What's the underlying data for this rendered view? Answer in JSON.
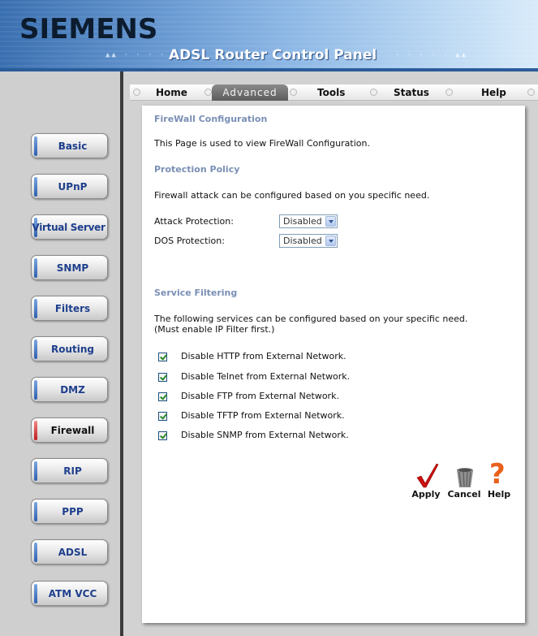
{
  "header": {
    "logo": "SIEMENS",
    "dots_left": "▲▲ · · · · · ·",
    "title": "ADSL Router Control Panel",
    "dots_right": "· · · · · ▲▲"
  },
  "topnav": {
    "items": [
      {
        "label": "Home"
      },
      {
        "label": "Advanced"
      },
      {
        "label": "Tools"
      },
      {
        "label": "Status"
      },
      {
        "label": "Help"
      }
    ],
    "active": "Advanced"
  },
  "sidebar": {
    "items": [
      {
        "label": "Basic"
      },
      {
        "label": "UPnP"
      },
      {
        "label": "Virtual Server"
      },
      {
        "label": "SNMP"
      },
      {
        "label": "Filters"
      },
      {
        "label": "Routing"
      },
      {
        "label": "DMZ"
      },
      {
        "label": "Firewall"
      },
      {
        "label": "RIP"
      },
      {
        "label": "PPP"
      },
      {
        "label": "ADSL"
      },
      {
        "label": "ATM VCC"
      }
    ],
    "active": "Firewall"
  },
  "content": {
    "title": "FireWall Configuration",
    "intro": "This Page is used to view FireWall Configuration.",
    "protection": {
      "title": "Protection Policy",
      "description": "Firewall attack can be configured based on you specific need.",
      "attack_label": "Attack Protection:",
      "attack_value": "Disabled",
      "dos_label": "DOS Protection:",
      "dos_value": "Disabled"
    },
    "service": {
      "title": "Service Filtering",
      "description_line1": "The following services can be configured based on your specific need.",
      "description_line2": "(Must enable IP Filter first.)",
      "options": [
        {
          "label": "Disable HTTP from External Network.",
          "checked": true
        },
        {
          "label": "Disable Telnet from External Network.",
          "checked": true
        },
        {
          "label": "Disable FTP from External Network.",
          "checked": true
        },
        {
          "label": "Disable TFTP from External Network.",
          "checked": true
        },
        {
          "label": "Disable SNMP from External Network.",
          "checked": true
        }
      ]
    },
    "actions": {
      "apply": "Apply",
      "cancel": "Cancel",
      "help": "Help",
      "help_glyph": "?"
    }
  },
  "colors": {
    "section_title": "#7a8fb5",
    "sidebar_label": "#1e3f8c",
    "apply_check": "#cc1111",
    "help_mark": "#e8601c"
  }
}
